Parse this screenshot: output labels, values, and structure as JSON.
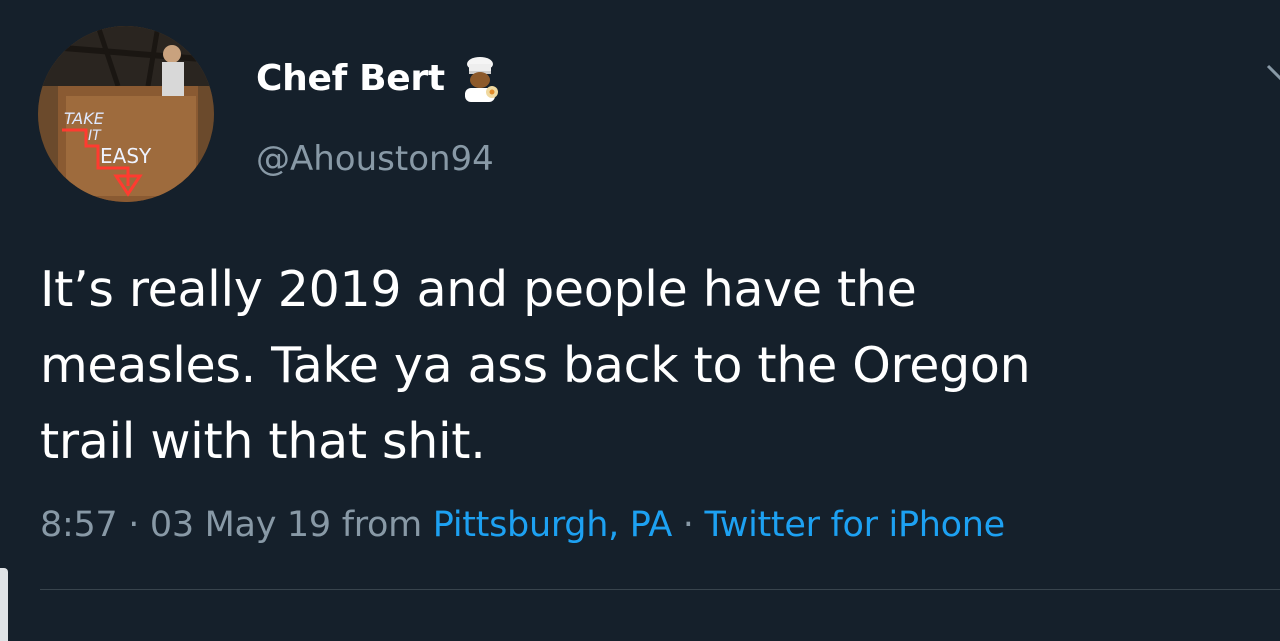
{
  "user": {
    "display_name": "Chef Bert",
    "name_emoji": "cook-emoji",
    "handle": "@Ahouston94",
    "avatar_sign_text": [
      "TAKE",
      "IT",
      "EASY"
    ]
  },
  "tweet": {
    "lines": [
      "It’s really 2019 and people have the",
      "measles. Take ya ass back to the Oregon",
      "trail with that shit."
    ]
  },
  "meta": {
    "time": "8:57",
    "separator": " · ",
    "date": "03 May 19",
    "from_word": " from ",
    "location": "Pittsburgh, PA",
    "source": "Twitter for iPhone"
  },
  "colors": {
    "background": "#15202b",
    "text_primary": "#ffffff",
    "text_secondary": "#8899a6",
    "link": "#1da1f2",
    "divider": "#38444d"
  }
}
